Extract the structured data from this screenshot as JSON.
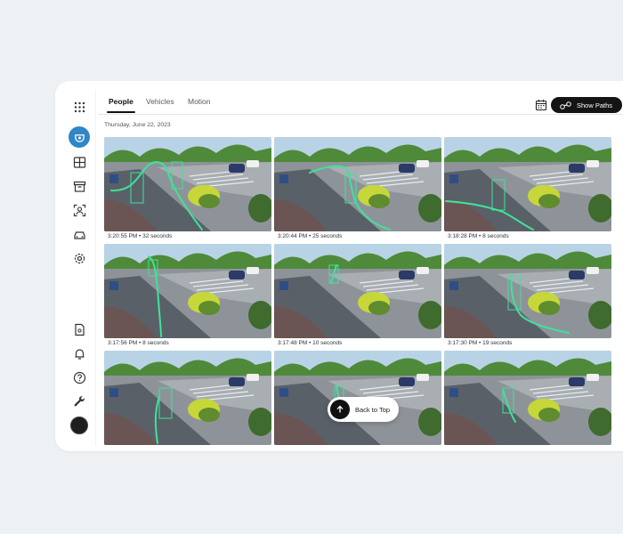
{
  "tabs": [
    {
      "label": "People",
      "active": true
    },
    {
      "label": "Vehicles",
      "active": false
    },
    {
      "label": "Motion",
      "active": false
    }
  ],
  "show_paths_label": "Show Paths",
  "date": "Thursday, June 22, 2023",
  "back_to_top_label": "Back to Top",
  "sidebar_icons": [
    "grid-dots-icon",
    "camera-icon",
    "layout-icon",
    "archive-icon",
    "face-scan-icon",
    "car-icon",
    "settings-icon",
    "document-icon",
    "bell-icon",
    "help-icon",
    "wrench-icon"
  ],
  "colors": {
    "accent": "#2f86c9",
    "path": "#3ee39a"
  },
  "clips": [
    {
      "caption": "3:20:55 PM • 32 seconds"
    },
    {
      "caption": "3:20:44 PM • 25 seconds"
    },
    {
      "caption": "3:18:28 PM • 8 seconds"
    },
    {
      "caption": "3:17:56 PM • 8 seconds"
    },
    {
      "caption": "3:17:48 PM • 10 seconds"
    },
    {
      "caption": "3:17:30 PM • 19 seconds"
    },
    {
      "caption": ""
    },
    {
      "caption": ""
    },
    {
      "caption": ""
    }
  ]
}
